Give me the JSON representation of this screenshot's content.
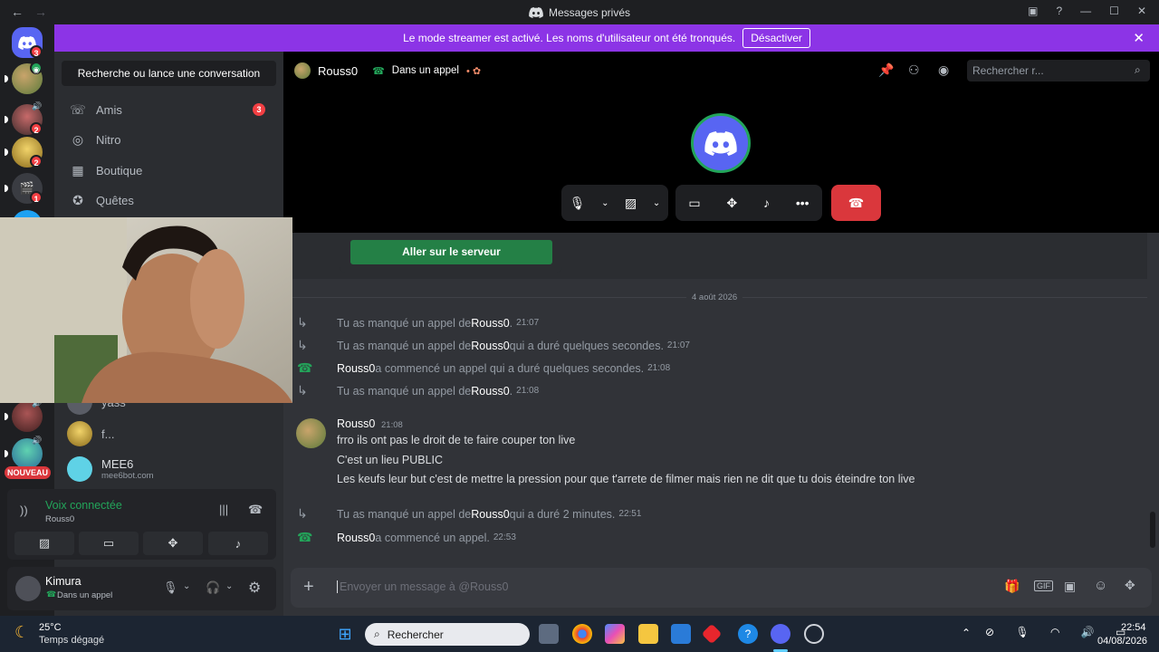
{
  "window": {
    "title": "Messages privés"
  },
  "banner": {
    "text": "Le mode streamer est activé. Les noms d'utilisateur ont été tronqués.",
    "button_label": "Désactiver"
  },
  "rail": {
    "badges": [
      "3",
      "2",
      "2",
      "1"
    ],
    "new_badge": "NOUVEAU"
  },
  "sidebar": {
    "search_label": "Recherche ou lance une conversation",
    "nav": [
      {
        "label": "Amis",
        "badge": "3",
        "icon": "friends-icon"
      },
      {
        "label": "Nitro",
        "icon": "nitro-icon"
      },
      {
        "label": "Boutique",
        "icon": "shop-icon"
      },
      {
        "label": "Quêtes",
        "icon": "quests-icon"
      }
    ],
    "dms": [
      {
        "name": "yass"
      },
      {
        "name": "f..."
      },
      {
        "name": "MEE6",
        "sub": "mee6bot.com"
      }
    ]
  },
  "voice": {
    "status": "Voix connectée",
    "channel": "Rouss0"
  },
  "user": {
    "name": "Kimura",
    "status": "Dans un appel"
  },
  "call": {
    "recipient": "Rouss0",
    "state": "Dans un appel",
    "search_placeholder": "Rechercher r...",
    "server_button": "Aller sur le serveur"
  },
  "chat": {
    "date_divider": "4 août 2026",
    "system": [
      {
        "pre": "Tu as manqué un appel de ",
        "name": "Rouss0",
        "post": ".",
        "time": "21:07",
        "type": "missed"
      },
      {
        "pre": "Tu as manqué un appel de ",
        "name": "Rouss0",
        "post": " qui a duré quelques secondes.",
        "time": "21:07",
        "type": "missed"
      },
      {
        "pre": "",
        "name": "Rouss0",
        "post": " a commencé un appel qui a duré quelques secondes.",
        "time": "21:08",
        "type": "started"
      },
      {
        "pre": "Tu as manqué un appel de ",
        "name": "Rouss0",
        "post": ".",
        "time": "21:08",
        "type": "missed"
      }
    ],
    "message": {
      "author": "Rouss0",
      "time": "21:08",
      "lines": [
        "frro ils ont pas le droit de te faire couper ton live",
        "C'est un lieu PUBLIC",
        "Les keufs leur but c'est de mettre la pression pour que t'arrete de filmer mais rien ne dit que tu dois éteindre ton live"
      ]
    },
    "system2": [
      {
        "pre": "Tu as manqué un appel de ",
        "name": "Rouss0",
        "post": " qui a duré 2 minutes.",
        "time": "22:51",
        "type": "missed"
      },
      {
        "pre": "",
        "name": "Rouss0",
        "post": " a commencé un appel.",
        "time": "22:53",
        "type": "started"
      }
    ],
    "composer_placeholder": "Envoyer un message à @Rouss0"
  },
  "taskbar": {
    "weather_temp": "25°C",
    "weather_desc": "Temps dégagé",
    "search": "Rechercher",
    "time": "22:54",
    "date": "04/08/2026"
  },
  "colors": {
    "banner": "#8c34e6",
    "accent_green": "#23a55a",
    "hangup_red": "#da373c",
    "badge_red": "#f23f43"
  }
}
